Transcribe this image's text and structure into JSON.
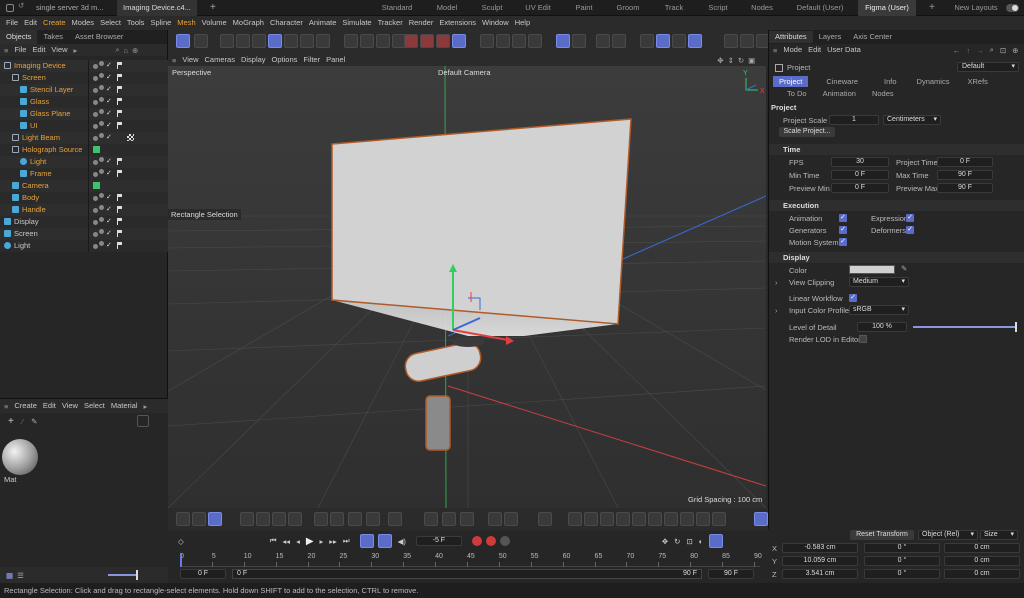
{
  "title_tabs": [
    "single server 3d m...",
    "Imaging Device.c4...",
    "+"
  ],
  "layouts": [
    "Standard",
    "Model",
    "Sculpt",
    "UV Edit",
    "Paint",
    "Groom",
    "Track",
    "Script",
    "Nodes",
    "Default (User)",
    "Figma (User)",
    "+",
    "New Layouts"
  ],
  "active_layout": "Figma (User)",
  "menu": [
    "File",
    "Edit",
    "Create",
    "Modes",
    "Select",
    "Tools",
    "Spline",
    "Mesh",
    "Volume",
    "MoGraph",
    "Character",
    "Animate",
    "Simulate",
    "Tracker",
    "Render",
    "Extensions",
    "Window",
    "Help"
  ],
  "left_panel": {
    "tabs": [
      "Objects",
      "Takes",
      "Asset Browser"
    ],
    "menu": [
      "File",
      "Edit",
      "View"
    ],
    "objects": [
      {
        "label": "Imaging Device",
        "indent": 0,
        "color": "#e8a23a",
        "icon": "null-icon",
        "marker": "flag"
      },
      {
        "label": "Screen",
        "indent": 1,
        "color": "#e8a23a",
        "icon": "null-icon",
        "marker": "flag"
      },
      {
        "label": "Stencil Layer",
        "indent": 2,
        "color": "#e8a23a",
        "icon": "plane-icon",
        "marker": "flag"
      },
      {
        "label": "Glass",
        "indent": 2,
        "color": "#e8a23a",
        "icon": "plane-icon",
        "marker": "flag"
      },
      {
        "label": "Glass Plane",
        "indent": 2,
        "color": "#e8a23a",
        "icon": "plane-icon",
        "marker": "flag"
      },
      {
        "label": "UI",
        "indent": 2,
        "color": "#e8a23a",
        "icon": "plane-icon",
        "marker": "flag"
      },
      {
        "label": "Light Beam",
        "indent": 1,
        "color": "#e8a23a",
        "icon": "null-icon",
        "marker": "checker"
      },
      {
        "label": "Holograph Source",
        "indent": 1,
        "color": "#e8a23a",
        "icon": "null-icon",
        "marker": "green"
      },
      {
        "label": "Light",
        "indent": 2,
        "color": "#e8a23a",
        "icon": "light-icon",
        "marker": "flag"
      },
      {
        "label": "Frame",
        "indent": 2,
        "color": "#e8a23a",
        "icon": "cube-icon",
        "marker": "flag"
      },
      {
        "label": "Camera",
        "indent": 1,
        "color": "#e8a23a",
        "icon": "camera-icon",
        "marker": "green"
      },
      {
        "label": "Body",
        "indent": 1,
        "color": "#e8a23a",
        "icon": "cube-icon",
        "marker": "flag"
      },
      {
        "label": "Handle",
        "indent": 1,
        "color": "#e8a23a",
        "icon": "cube-icon",
        "marker": "flag"
      },
      {
        "label": "Display",
        "indent": 0,
        "color": "#c8c8c8",
        "icon": "plane-icon",
        "marker": "flag"
      },
      {
        "label": "Screen",
        "indent": 0,
        "color": "#c8c8c8",
        "icon": "plane-icon",
        "marker": "flag"
      },
      {
        "label": "Light",
        "indent": 0,
        "color": "#c8c8c8",
        "icon": "light-icon",
        "marker": "flag"
      }
    ],
    "material_menu": [
      "Create",
      "Edit",
      "View",
      "Select",
      "Material"
    ],
    "material_name": "Mat"
  },
  "viewport": {
    "menu": [
      "View",
      "Cameras",
      "Display",
      "Options",
      "Filter",
      "Panel"
    ],
    "label": "Perspective",
    "camera": "Default Camera",
    "tool_hint": "Rectangle Selection",
    "grid_spacing": "Grid Spacing : 100 cm"
  },
  "timeline": {
    "frame_field": "-5 F",
    "ticks": [
      "0",
      "5",
      "10",
      "15",
      "20",
      "25",
      "30",
      "35",
      "40",
      "45",
      "50",
      "55",
      "60",
      "65",
      "70",
      "75",
      "80",
      "85",
      "90"
    ],
    "start": "0 F",
    "start2": "0 F",
    "end": "90 F",
    "end2": "90 F"
  },
  "attributes": {
    "tabs": [
      "Attributes",
      "Layers",
      "Axis Center"
    ],
    "menu": [
      "Mode",
      "Edit",
      "User Data"
    ],
    "object_label": "Project",
    "preset": "Default",
    "subtabs1": [
      "Project",
      "Cineware",
      "Info",
      "Dynamics",
      "XRefs"
    ],
    "subtabs2": [
      "To Do",
      "Animation",
      "Nodes"
    ],
    "section_project": "Project",
    "project_scale_label": "Project Scale",
    "project_scale": "1",
    "project_unit": "Centimeters",
    "scale_button": "Scale Project...",
    "section_time": "Time",
    "fps_label": "FPS",
    "fps": "30",
    "project_time_label": "Project Time",
    "project_time": "0 F",
    "min_time_label": "Min Time",
    "min_time": "0 F",
    "max_time_label": "Max Time",
    "max_time": "90 F",
    "preview_min_label": "Preview Min",
    "preview_min": "0 F",
    "preview_max_label": "Preview Max",
    "preview_max": "90 F",
    "section_execution": "Execution",
    "animation_label": "Animation",
    "expression_label": "Expression",
    "generators_label": "Generators",
    "deformers_label": "Deformers",
    "motion_label": "Motion System",
    "section_display": "Display",
    "color_label": "Color",
    "color_value": "#d0d0d0",
    "clipping_label": "View Clipping",
    "clipping": "Medium",
    "linear_label": "Linear Workflow",
    "profile_label": "Input Color Profile",
    "profile": "sRGB",
    "lod_label": "Level of Detail",
    "lod": "100 %",
    "lod_fraction": 1.0,
    "render_lod_label": "Render LOD in Editor"
  },
  "coordinates": {
    "reset_button": "Reset Transform",
    "mode": "Object (Rel)",
    "size_mode": "Size",
    "rows": [
      {
        "axis": "X",
        "pos": "-0.583 cm",
        "rot": "0 °",
        "size": "0 cm"
      },
      {
        "axis": "Y",
        "pos": "10.059 cm",
        "rot": "0 °",
        "size": "0 cm"
      },
      {
        "axis": "Z",
        "pos": "3.541 cm",
        "rot": "0 °",
        "size": "0 cm"
      }
    ]
  },
  "status": "Rectangle Selection: Click and drag to rectangle-select elements. Hold down SHIFT to add to the selection, CTRL to remove."
}
